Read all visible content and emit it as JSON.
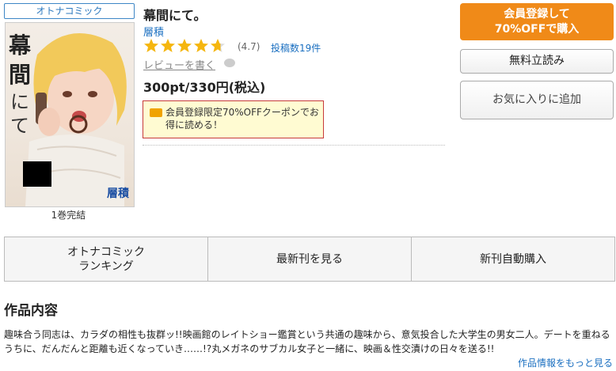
{
  "badge": "オトナコミック",
  "cover": {
    "title_chars": [
      "幕",
      "間",
      "に",
      "て"
    ],
    "author_stamp": "層積",
    "volumes_caption": "1巻完結"
  },
  "book": {
    "title": "幕間にて。",
    "author": "層積",
    "rating_value": 4.7,
    "rating_text": "(4.7)",
    "post_count": "投稿数19件",
    "review_link": "レビューを書く",
    "price": "300pt/330円(税込)"
  },
  "coupon": {
    "text": "会員登録限定70%OFFクーポンでお得に読める！"
  },
  "actions": {
    "register_line1": "会員登録して",
    "register_line2": "70%OFFで購入",
    "trial": "無料立読み",
    "favorite": "お気に入りに追加"
  },
  "nav": {
    "ranking_line1": "オトナコミック",
    "ranking_line2": "ランキング",
    "latest": "最新刊を見る",
    "auto_buy": "新刊自動購入"
  },
  "synopsis": {
    "heading": "作品内容",
    "text": "趣味合う同志は、カラダの相性も抜群ッ!!映画館のレイトショー鑑賞という共通の趣味から、意気投合した大学生の男女二人。デートを重ねるうちに、だんだんと距離も近くなっていき……!?丸メガネのサブカル女子と一緒に、映画＆性交漬けの日々を送る!!",
    "more_link": "作品情報をもっと見る"
  },
  "colors": {
    "accent_orange": "#f08a18",
    "link_blue": "#1a6fc0",
    "star_gold": "#f5b60f",
    "coupon_border": "#c73a3a"
  }
}
